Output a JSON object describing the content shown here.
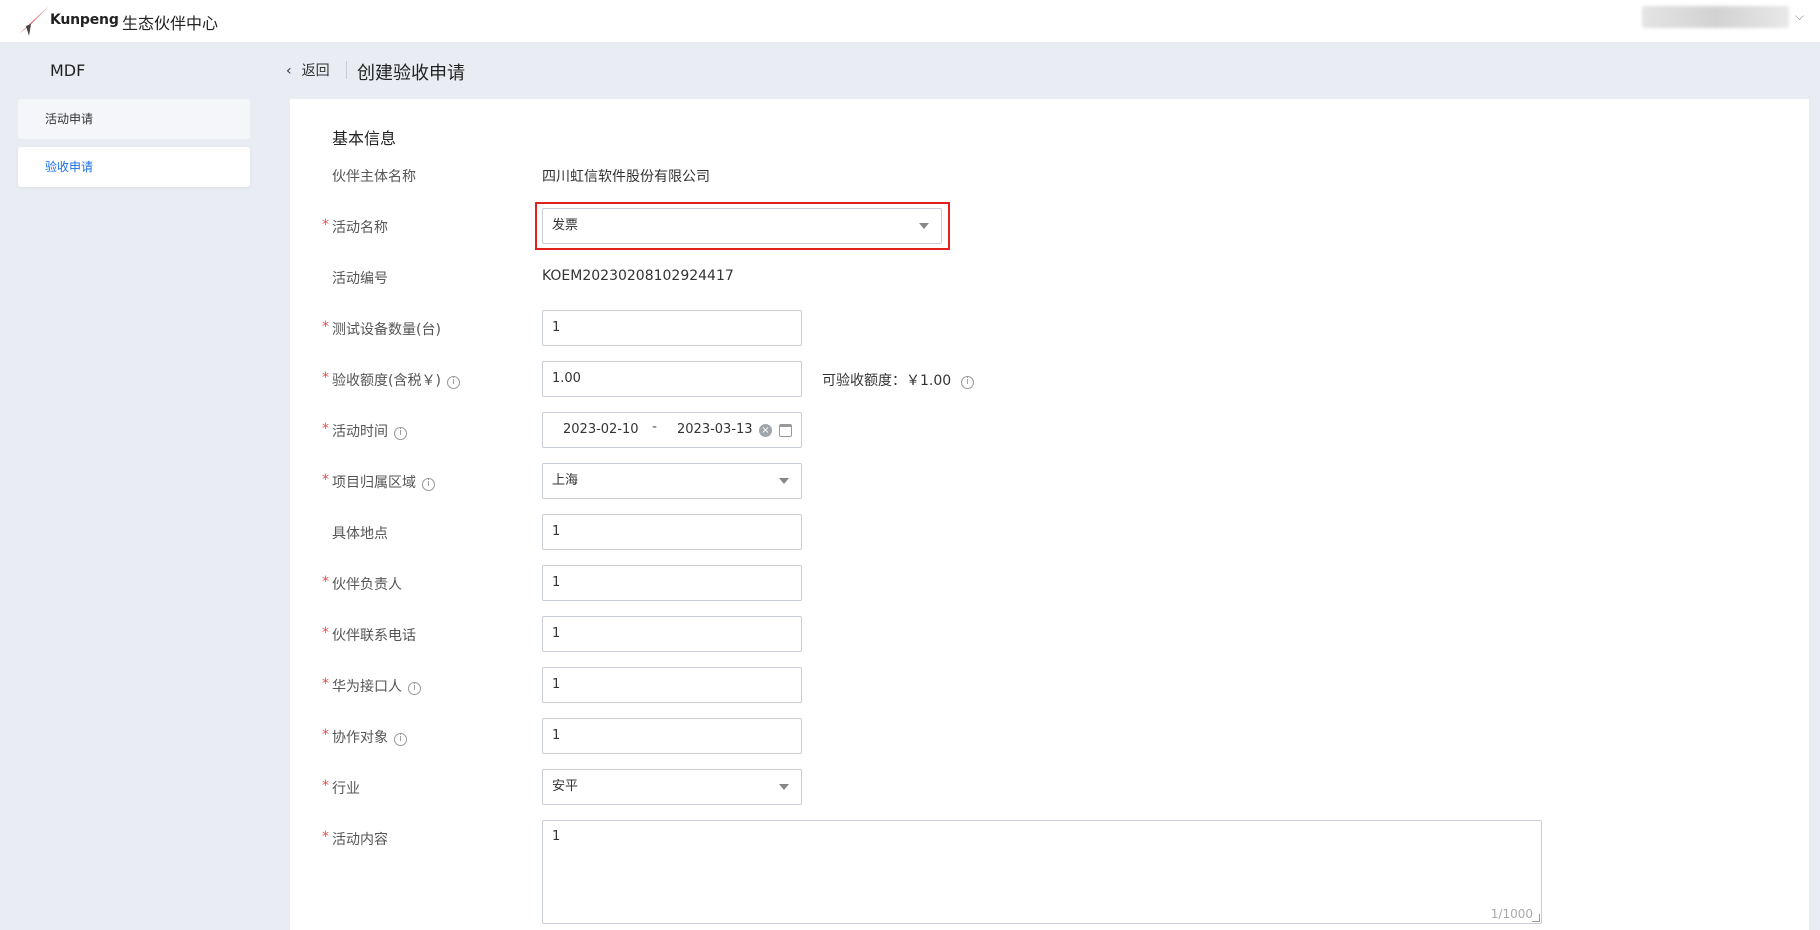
{
  "header": {
    "logo_text": "Kunpeng",
    "app_title": "生态伙伴中心",
    "user_chevron": "⌵"
  },
  "sidebar": {
    "title": "MDF",
    "items": [
      {
        "label": "活动申请",
        "active": false
      },
      {
        "label": "验收申请",
        "active": true
      }
    ]
  },
  "nav": {
    "back_label": "返回",
    "back_chevron": "‹",
    "page_title": "创建验收申请"
  },
  "form": {
    "section_title": "基本信息",
    "required_mark": "*",
    "info_glyph": "i",
    "partner_name": {
      "label": "伙伴主体名称",
      "value": "四川虹信软件股份有限公司"
    },
    "activity_name": {
      "label": "活动名称",
      "value": "发票"
    },
    "activity_id": {
      "label": "活动编号",
      "value": "KOEM20230208102924417"
    },
    "device_count": {
      "label": "测试设备数量(台)",
      "value": "1"
    },
    "acceptance_amount": {
      "label": "验收额度(含税￥)",
      "value": "1.00",
      "quota_text": "可验收额度：￥1.00"
    },
    "activity_time": {
      "label": "活动时间",
      "start": "2023-02-10",
      "separator": "-",
      "end": "2023-03-13",
      "clear_glyph": "×"
    },
    "region": {
      "label": "项目归属区域",
      "value": "上海"
    },
    "location": {
      "label": "具体地点",
      "value": "1"
    },
    "partner_owner": {
      "label": "伙伴负责人",
      "value": "1"
    },
    "partner_phone": {
      "label": "伙伴联系电话",
      "value": "1"
    },
    "huawei_contact": {
      "label": "华为接口人",
      "value": "1"
    },
    "collaborator": {
      "label": "协作对象",
      "value": "1"
    },
    "industry": {
      "label": "行业",
      "value": "安平"
    },
    "activity_content": {
      "label": "活动内容",
      "value": "1",
      "counter": "1/1000"
    }
  },
  "colors": {
    "accent": "#1a6fe0",
    "required": "#e64c4c",
    "highlight": "#e3201c"
  }
}
